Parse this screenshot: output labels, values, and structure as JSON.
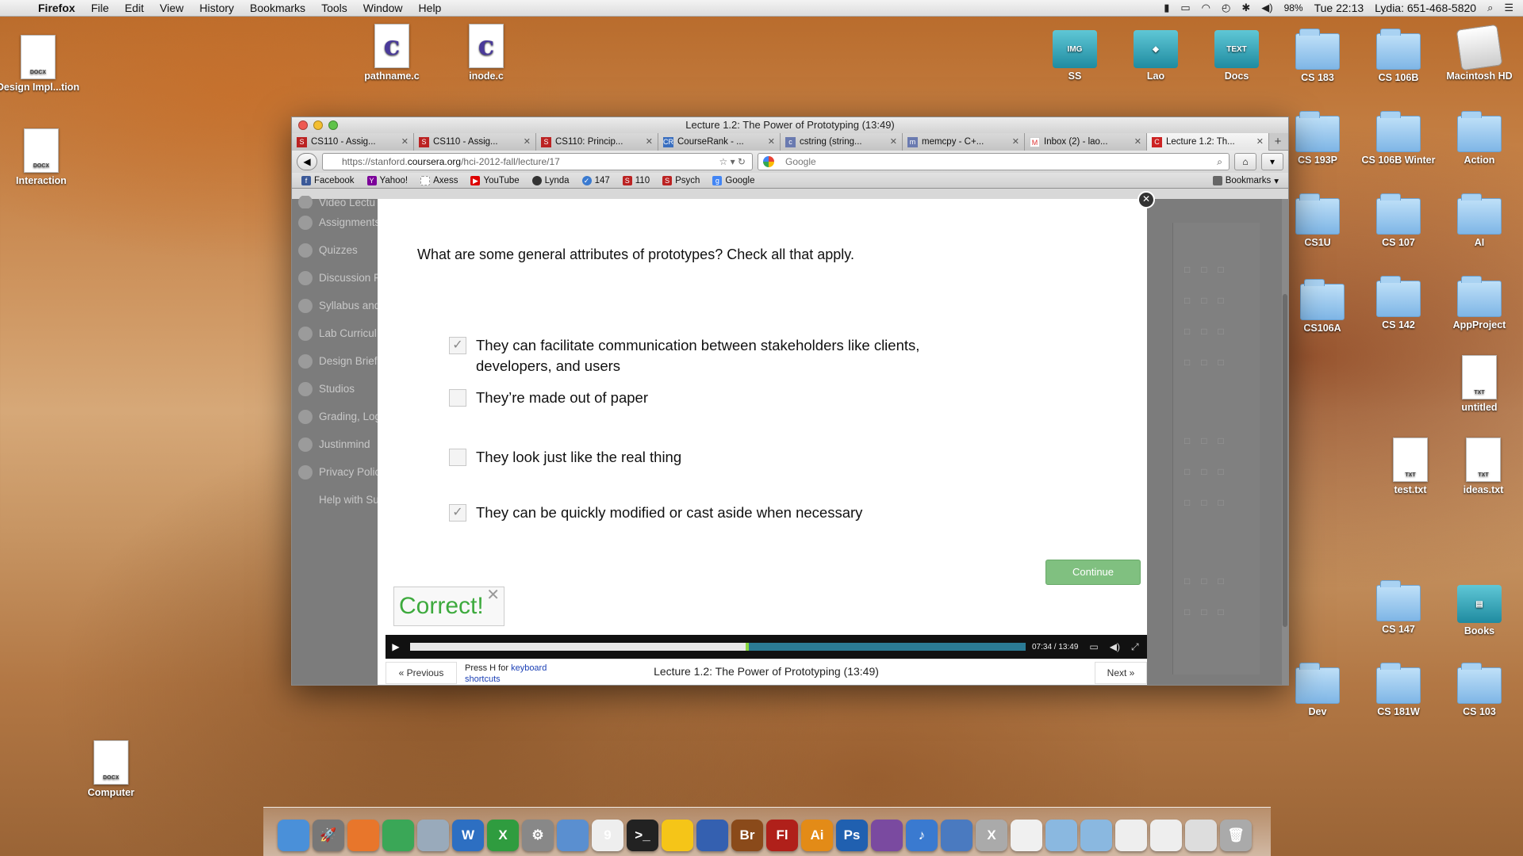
{
  "menubar": {
    "app": "Firefox",
    "items": [
      "File",
      "Edit",
      "View",
      "History",
      "Bookmarks",
      "Tools",
      "Window",
      "Help"
    ],
    "battery": "98%",
    "clock": "Tue 22:13",
    "user": "Lydia: 651-468-5820"
  },
  "desktop": {
    "left_icons": [
      "Design Impl...tion",
      "Interaction",
      "Computer"
    ],
    "doc_tag": "DOCX",
    "txt_tag": "TXT",
    "top_icons": [
      "pathname.c",
      "inode.c",
      "SS",
      "Lao",
      "Docs"
    ],
    "right_icons": [
      "CS 183",
      "CS 106B",
      "Macintosh HD",
      "CS 193P",
      "CS 106B Winter",
      "Action",
      "CS1U",
      "CS 107",
      "AI",
      "CS106A",
      "CS 142",
      "AppProject",
      "untitled",
      "test.txt",
      "ideas.txt",
      "CS 147",
      "Books",
      "Dev",
      "CS 181W",
      "CS 103"
    ]
  },
  "browser": {
    "title": "Lecture 1.2: The Power of Prototyping (13:49)",
    "tabs": [
      {
        "label": "CS110 - Assig...",
        "fav": "S"
      },
      {
        "label": "CS110 - Assig...",
        "fav": "S"
      },
      {
        "label": "CS110: Princip...",
        "fav": "S"
      },
      {
        "label": "CourseRank - ...",
        "fav": "CR"
      },
      {
        "label": "cstring (string...",
        "fav": "c"
      },
      {
        "label": "memcpy - C+...",
        "fav": "m"
      },
      {
        "label": "Inbox (2) - lao...",
        "fav": "M"
      },
      {
        "label": "Lecture 1.2: Th...",
        "fav": "C"
      }
    ],
    "url_prefix": "https://stanford.",
    "url_domain": "coursera.org",
    "url_path": "/hci-2012-fall/lecture/17",
    "search_placeholder": "Google",
    "bookmarks": [
      "Facebook",
      "Yahoo!",
      "Axess",
      "YouTube",
      "Lynda",
      "147",
      "110",
      "Psych",
      "Google"
    ],
    "bookmarks_menu": "Bookmarks"
  },
  "sidebar": [
    "Video Lectu",
    "Assignments",
    "Quizzes",
    "Discussion F",
    "Syllabus and",
    "Lab Curricul",
    "Design Briefs",
    "Studios",
    "Grading, Log",
    "Justinmind",
    "Privacy Polic",
    "Help with Su"
  ],
  "quiz": {
    "question": "What are some general attributes of prototypes? Check all that apply.",
    "options": [
      {
        "text": "They can facilitate communication between stakeholders like clients,",
        "text2": "developers, and users",
        "checked": "✓"
      },
      {
        "text": "They’re made out of paper",
        "checked": ""
      },
      {
        "text": "They look just like the real thing",
        "checked": ""
      },
      {
        "text": "They can be quickly modified or cast aside when necessary",
        "checked": "✓"
      }
    ],
    "continue": "Continue",
    "feedback": "Correct!"
  },
  "player": {
    "time": "07:34 / 13:49",
    "progress": 0.545
  },
  "footer": {
    "prev": "« Previous",
    "press": "Press H for",
    "keyboard": "keyboard shortcuts",
    "title": "Lecture 1.2: The Power of Prototyping (13:49)",
    "next": "Next »"
  },
  "dock": [
    {
      "n": "finder",
      "c": "#4a90d9",
      "t": ""
    },
    {
      "n": "launchpad",
      "c": "#777",
      "t": "🚀"
    },
    {
      "n": "firefox",
      "c": "#e8762b",
      "t": ""
    },
    {
      "n": "chrome",
      "c": "#3aa757",
      "t": ""
    },
    {
      "n": "preview",
      "c": "#9ab",
      "t": ""
    },
    {
      "n": "word",
      "c": "#2d6fc2",
      "t": "W"
    },
    {
      "n": "excel",
      "c": "#2f9c3f",
      "t": "X"
    },
    {
      "n": "system-prefs",
      "c": "#888",
      "t": "⚙"
    },
    {
      "n": "xcode",
      "c": "#5a8fd0",
      "t": ""
    },
    {
      "n": "calendar",
      "c": "#eee",
      "t": "9"
    },
    {
      "n": "terminal",
      "c": "#222",
      "t": ">_"
    },
    {
      "n": "adium",
      "c": "#f5c518",
      "t": ""
    },
    {
      "n": "network",
      "c": "#3460b0",
      "t": ""
    },
    {
      "n": "bridge",
      "c": "#8a4a1a",
      "t": "Br"
    },
    {
      "n": "flash",
      "c": "#b0201a",
      "t": "Fl"
    },
    {
      "n": "illustrator",
      "c": "#e38b17",
      "t": "Ai"
    },
    {
      "n": "photoshop",
      "c": "#2060b0",
      "t": "Ps"
    },
    {
      "n": "iphoto",
      "c": "#7a4aa0",
      "t": ""
    },
    {
      "n": "itunes",
      "c": "#3a7ad0",
      "t": "♪"
    },
    {
      "n": "xcode2",
      "c": "#4a7ac0",
      "t": ""
    },
    {
      "n": "x11",
      "c": "#aaa",
      "t": "X"
    },
    {
      "n": "textedit",
      "c": "#f0f0f0",
      "t": ""
    },
    {
      "n": "apps",
      "c": "#8ab8e0",
      "t": ""
    },
    {
      "n": "docs",
      "c": "#8ab8e0",
      "t": ""
    },
    {
      "n": "file1",
      "c": "#eee",
      "t": ""
    },
    {
      "n": "file2",
      "c": "#eee",
      "t": ""
    },
    {
      "n": "downloads",
      "c": "#ddd",
      "t": ""
    },
    {
      "n": "trash",
      "c": "#aaa",
      "t": "🗑"
    }
  ]
}
